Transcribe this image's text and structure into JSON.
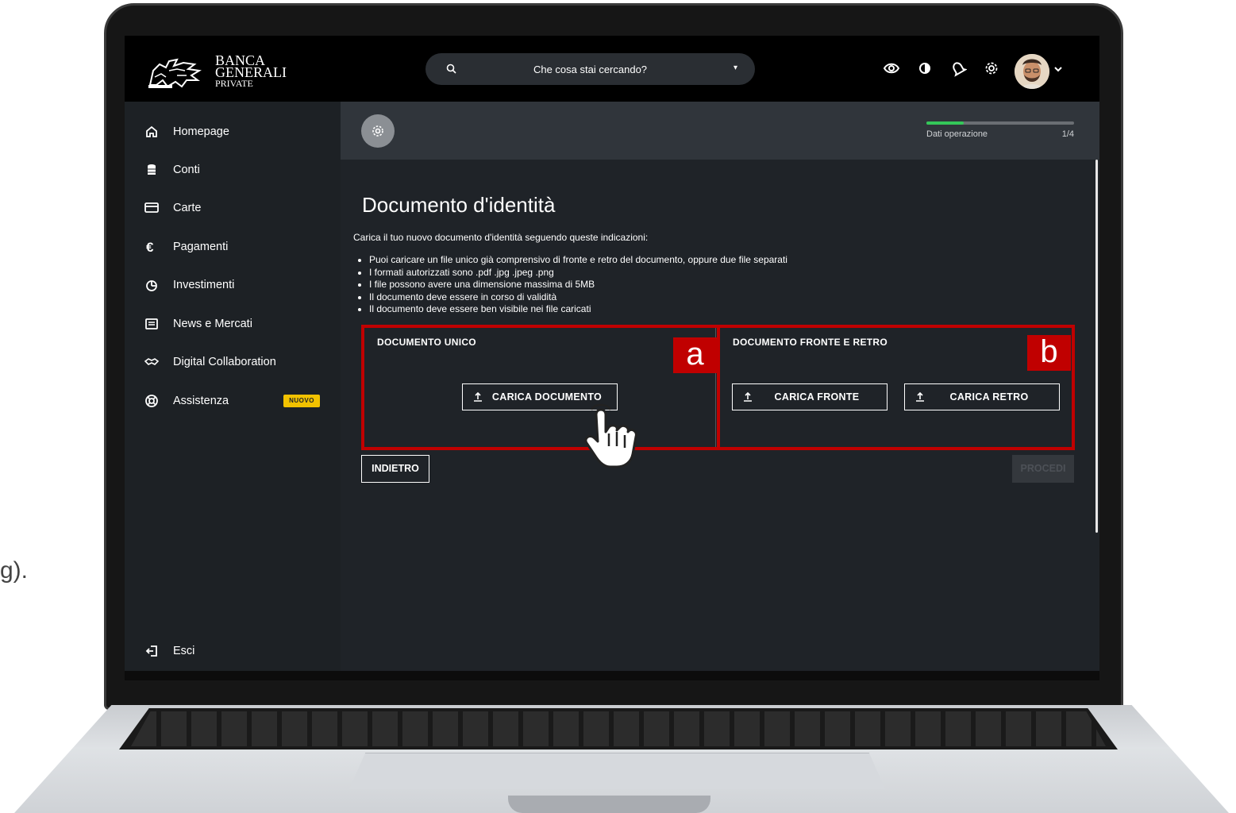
{
  "side_fragment": "g).",
  "brand": {
    "name_line1": "BANCA",
    "name_line2": "GENERALI",
    "name_line3": "PRIVATE"
  },
  "search": {
    "placeholder": "Che cosa stai cercando?"
  },
  "sidebar": {
    "items": [
      {
        "label": "Homepage",
        "icon": "home-icon"
      },
      {
        "label": "Conti",
        "icon": "database-icon"
      },
      {
        "label": "Carte",
        "icon": "card-icon"
      },
      {
        "label": "Pagamenti",
        "icon": "euro-icon"
      },
      {
        "label": "Investimenti",
        "icon": "pie-chart-icon"
      },
      {
        "label": "News e Mercati",
        "icon": "news-icon"
      },
      {
        "label": "Digital Collaboration",
        "icon": "handshake-icon"
      },
      {
        "label": "Assistenza",
        "icon": "lifebuoy-icon",
        "badge": "NUOVO"
      }
    ],
    "logout": "Esci"
  },
  "progress": {
    "label": "Dati operazione",
    "step": "1/4",
    "fraction": 0.25,
    "color": "#34c759"
  },
  "page": {
    "title": "Documento d'identità",
    "intro": "Carica il tuo nuovo documento d'identità seguendo queste indicazioni:",
    "rules": [
      "Puoi caricare un file unico già comprensivo di fronte e retro del documento, oppure due file separati",
      "I formati autorizzati sono .pdf .jpg .jpeg .png",
      "I file possono avere una dimensione massima di 5MB",
      "Il documento deve essere in corso di validità",
      "Il documento deve essere ben visibile nei file caricati"
    ]
  },
  "upload": {
    "single": {
      "title": "DOCUMENTO UNICO",
      "button": "CARICA DOCUMENTO",
      "tag": "a"
    },
    "double": {
      "title": "DOCUMENTO FRONTE E RETRO",
      "front_button": "CARICA FRONTE",
      "back_button": "CARICA RETRO",
      "tag": "b"
    }
  },
  "actions": {
    "back": "INDIETRO",
    "proceed": "PROCEDI"
  },
  "colors": {
    "highlight": "#c00000",
    "badge": "#f2c200",
    "background": "#1f2328"
  }
}
